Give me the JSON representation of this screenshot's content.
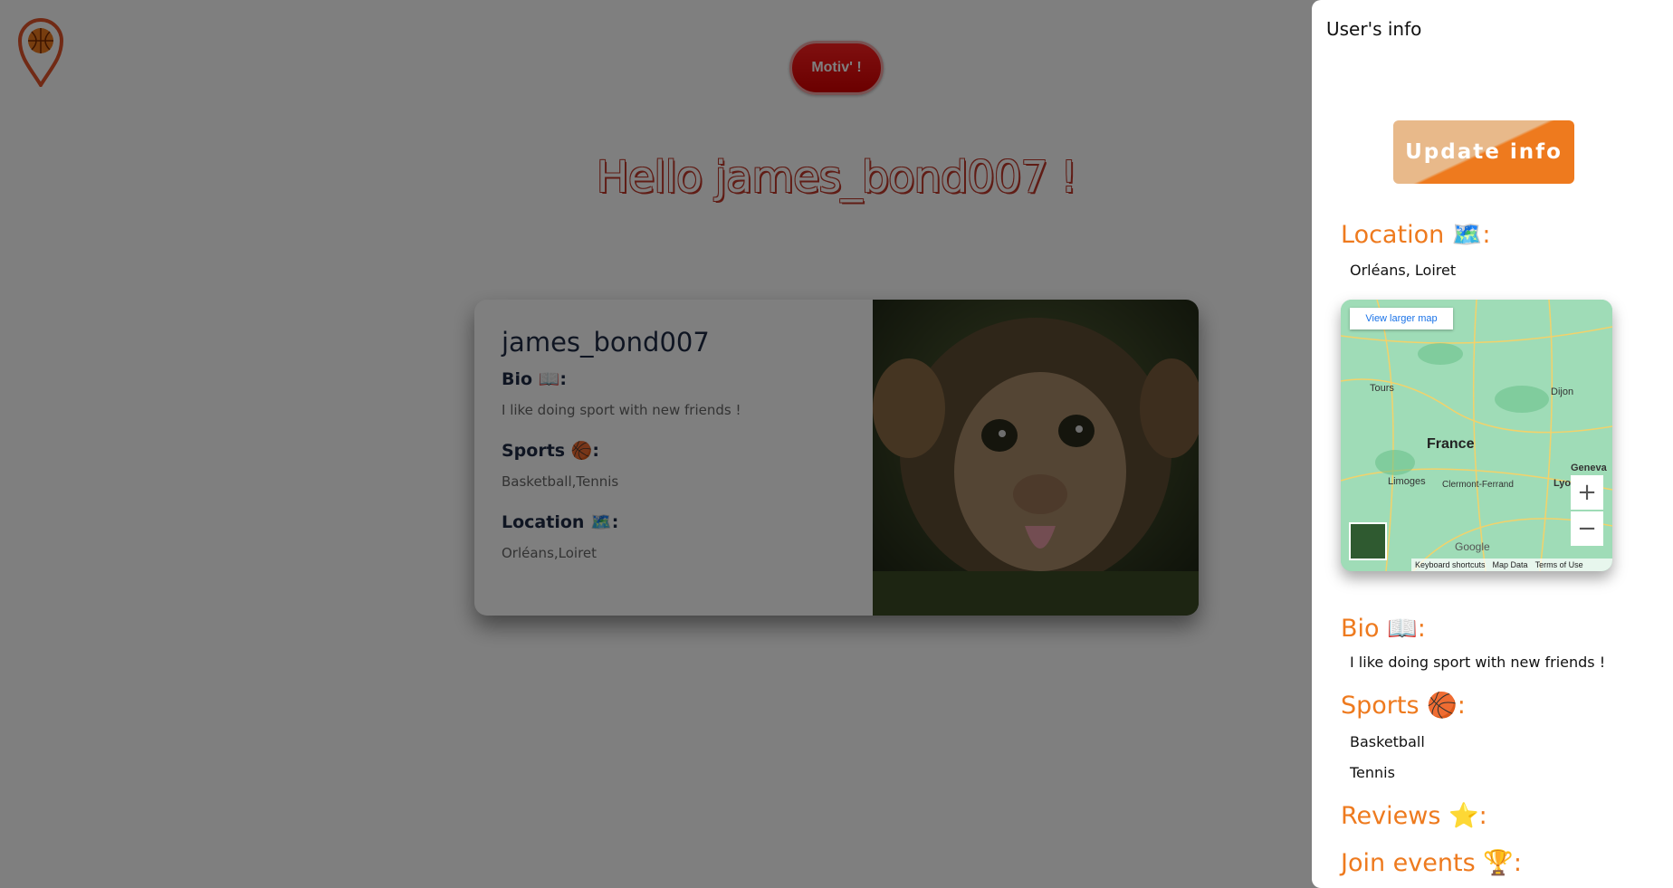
{
  "header": {
    "motiv_label": "Motiv' !"
  },
  "greeting": "Hello james_bond007 !",
  "card": {
    "username": "james_bond007",
    "bio_label": "Bio 📖:",
    "bio": "I like doing sport with new friends !",
    "sports_label": "Sports 🏀:",
    "sports": "Basketball,Tennis",
    "location_label": "Location 🗺️:",
    "location": "Orléans,Loiret"
  },
  "panel": {
    "title": "User's info",
    "update_label": "Update info",
    "location_title": "Location 🗺️:",
    "location": "Orléans, Loiret",
    "map": {
      "view_larger": "View larger map",
      "labels": [
        "Tours",
        "Dijon",
        "France",
        "Geneva",
        "Limoges",
        "Clermont-Ferrand",
        "Lyon"
      ],
      "zoom_in": "+",
      "zoom_out": "−",
      "google": "Google",
      "footer": [
        "Keyboard shortcuts",
        "Map Data",
        "Terms of Use"
      ]
    },
    "bio_title": "Bio 📖:",
    "bio": "I like doing sport with new friends !",
    "sports_title": "Sports 🏀:",
    "sports": [
      "Basketball",
      "Tennis"
    ],
    "reviews_title": "Reviews ⭐:",
    "events_title": "Join events 🏆:"
  },
  "colors": {
    "accent": "#ee7a1e",
    "motiv": "#e00000",
    "name": "#1f2b45"
  }
}
